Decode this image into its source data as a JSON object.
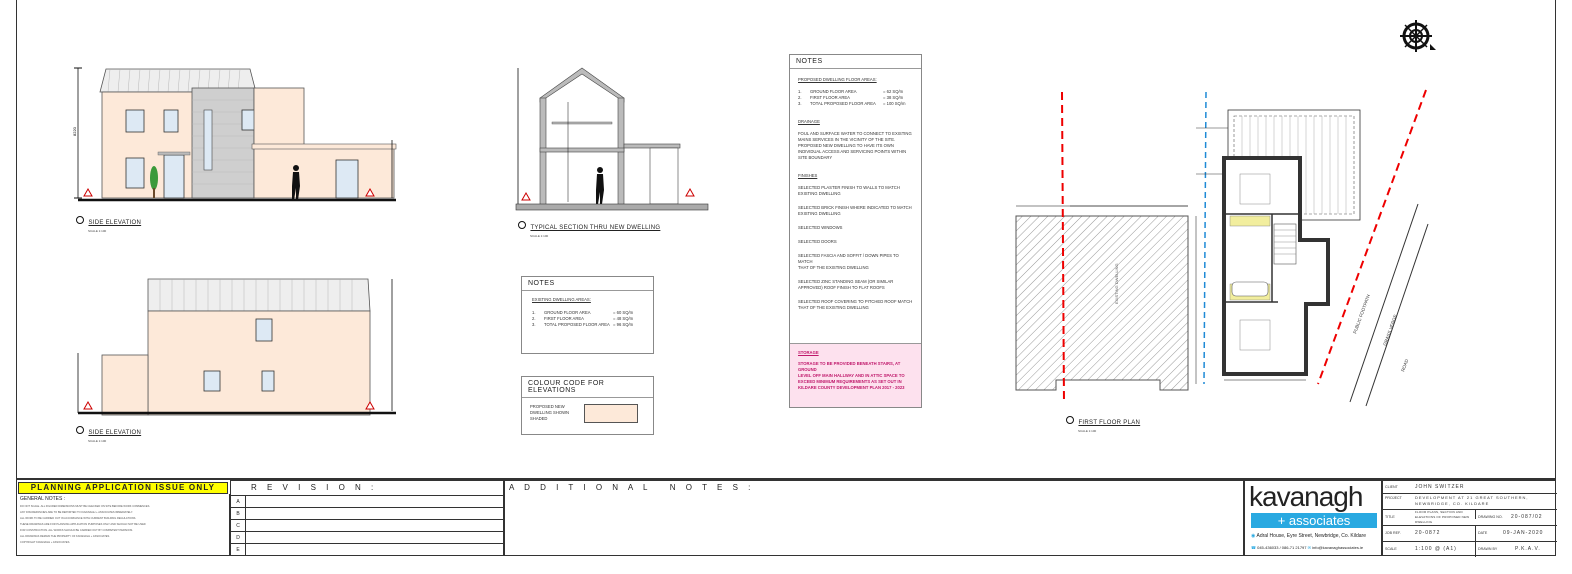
{
  "drawings": {
    "side_elevation_1": {
      "caption": "SIDE ELEVATION",
      "scale": "SCALE 1:100"
    },
    "side_elevation_2": {
      "caption": "SIDE ELEVATION",
      "scale": "SCALE 1:100"
    },
    "section": {
      "caption": "TYPICAL SECTION THRU NEW DWELLING",
      "scale": "SCALE 1:100"
    },
    "first_floor": {
      "caption": "FIRST FLOOR PLAN",
      "scale": "SCALE 1:100"
    }
  },
  "notes_main": {
    "title": "NOTES",
    "floor_heading": "PROPOSED DWELLING FLOOR AREAS:",
    "floor_rows": [
      {
        "n": "1.",
        "label": "GROUND FLOOR AREA",
        "val": "= 62 SQ/m"
      },
      {
        "n": "2.",
        "label": "FIRST FLOOR AREA",
        "val": "= 38 SQ/m"
      },
      {
        "n": "3.",
        "label": "TOTAL PROPOSED FLOOR AREA",
        "val": "= 100 SQ/m"
      }
    ],
    "drainage_heading": "DRAINAGE",
    "drainage_text": [
      "FOUL AND SURFACE WATER TO CONNECT TO EXISTING",
      "MAINS SERVICES IN THE VICINITY OF THE SITE.",
      "PROPOSED NEW DWELLING TO HAVE ITS OWN",
      "INDIVIDUAL ACCESS AND SERVICING POINTS WITHIN",
      "SITE BOUNDARY"
    ],
    "finishes_heading": "FINISHES",
    "finishes": [
      [
        "SELECTED PLASTER FINISH TO WALLS TO MATCH",
        "EXISTING DWELLING"
      ],
      [
        "SELECTED BRICK FINISH WHERE INDICATED TO MATCH",
        "EXISTING DWELLING"
      ],
      [
        "SELECTED WINDOWS"
      ],
      [
        "SELECTED DOORS"
      ],
      [
        "SELECTED FASCIA AND SOFFIT / DOWN PIPES TO MATCH",
        "THAT OF THE EXISTING DWELLING"
      ],
      [
        "SELECTED ZINC STANDING SEAM (OR SIMILAR",
        "APPROVED) ROOF FINISH TO FLAT ROOFS"
      ],
      [
        "SELECTED ROOF COVERING TO PITCHED ROOF MATCH",
        "THAT OF THE EXISTING DWELLING"
      ]
    ],
    "storage_heading": "STORAGE",
    "storage_text": [
      "STORAGE TO BE PROVIDED BENEATH STAIRS, AT GROUND",
      "LEVEL OFF MAIN HALLWAY AND IN ATTIC SPACE TO",
      "EXCEED MINIMUM REQUIREMENTS AS SET OUT IN",
      "KILDARE COUNTY DEVELOPMENT PLAN 2017 - 2023"
    ]
  },
  "notes_existing": {
    "title": "NOTES",
    "heading": "EXISTING DWELLING AREAS:",
    "rows": [
      {
        "n": "1.",
        "label": "GROUND FLOOR AREA",
        "val": "= 60 SQ/m"
      },
      {
        "n": "2.",
        "label": "FIRST FLOOR AREA",
        "val": "= 48 SQ/m"
      },
      {
        "n": "3.",
        "label": "TOTAL PROPOSED FLOOR AREA",
        "val": "= 96 SQ/m"
      }
    ]
  },
  "colour_code": {
    "title": "COLOUR CODE FOR ELEVATIONS",
    "label_lines": [
      "PROPOSED NEW",
      "DWELLING SHOWN",
      "SHADED"
    ],
    "swatch": "#fde9d9"
  },
  "plan_labels": {
    "public_footpath": "PUBLIC FOOTPATH",
    "grass_verge": "GRASS VERGE",
    "road": "ROAD",
    "existing_dwelling": "EXISTING DWELLING"
  },
  "title_block": {
    "planning": "PLANNING APPLICATION ISSUE ONLY",
    "general_notes_title": "GENERAL NOTES :",
    "general_notes": [
      "DO NOT SCALE. ALL FIGURED DIMENSIONS MUST BE CHECKED ON SITE BEFORE WORK COMMENCES.",
      "ANY DISCREPANCIES ARE TO BE REPORTED TO KAVANAGH + ASSOCIATES IMMEDIATELY.",
      "ALL WORK TO BE CARRIED OUT IN ACCORDANCE WITH CURRENT BUILDING REGULATIONS.",
      "THESE DRAWINGS ARE FOR PLANNING APPLICATION PURPOSES ONLY AND SHOULD NOT BE USED",
      "FOR CONSTRUCTION. ALL WORKS SHOULD BE CARRIED OUT BY COMPETENT PERSONS.",
      "ALL DRAWINGS REMAIN THE PROPERTY OF KAVANAGH + ASSOCIATES.",
      "COPYRIGHT KAVANAGH + ASSOCIATES."
    ],
    "revision_title": "R E V I S I O N :",
    "revision_letters": [
      "A",
      "B",
      "C",
      "D",
      "E"
    ],
    "additional_notes_title": "A D D I T I O N A L   N O T E S :",
    "logo_main": "kavanagh",
    "logo_sub": "+ associates",
    "address": "Adral House, Eyre Street, Newbridge, Co. Kildare",
    "phone": "045-436033 / 086-71 21797",
    "email": "info@kavanaghassociates.ie",
    "client_label": "CLIENT",
    "client": "JOHN SWITZER",
    "project_label": "PROJECT",
    "project_lines": [
      "DEVELOPMENT AT 21 GREAT SOUTHERN,",
      "NEWBRIDGE, CO. KILDARE"
    ],
    "title_label": "TITLE",
    "title_lines": [
      "FLOOR PLANS, SECTION AND",
      "ELEVATIONS OF PROPOSED NEW",
      "DWELLING"
    ],
    "drawing_no_label": "DRAWING NO.",
    "drawing_no": "20-087/02",
    "job_ref_label": "JOB REF.",
    "job_ref": "20-0872",
    "date_label": "DATE",
    "date": "09-JAN-2020",
    "scale_label": "SCALE",
    "scale": "1:100 @ (A1)",
    "drawn_label": "DRAWN BY",
    "drawn": "P.K.A.V."
  }
}
